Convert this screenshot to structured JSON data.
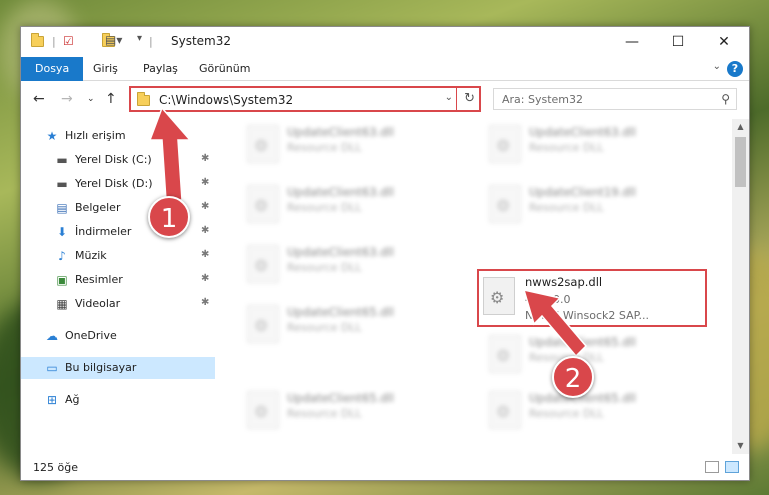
{
  "window": {
    "title": "System32",
    "controls": {
      "minimize": "—",
      "maximize": "☐",
      "close": "✕"
    }
  },
  "ribbon": {
    "tabs": [
      "Dosya",
      "Giriş",
      "Paylaş",
      "Görünüm"
    ]
  },
  "navigation": {
    "address": "C:\\Windows\\System32",
    "search_placeholder": "Ara: System32"
  },
  "sidebar": {
    "items": [
      {
        "label": "Hızlı erişim",
        "icon": "star-icon"
      },
      {
        "label": "Yerel Disk (C:)",
        "icon": "drive-icon",
        "pinned": true
      },
      {
        "label": "Yerel Disk (D:)",
        "icon": "drive-icon",
        "pinned": true
      },
      {
        "label": "Belgeler",
        "icon": "document-icon",
        "pinned": true
      },
      {
        "label": "İndirmeler",
        "icon": "download-icon",
        "pinned": true
      },
      {
        "label": "Müzik",
        "icon": "music-icon",
        "pinned": true
      },
      {
        "label": "Resimler",
        "icon": "picture-icon",
        "pinned": true
      },
      {
        "label": "Videolar",
        "icon": "video-icon",
        "pinned": true
      },
      {
        "label": "OneDrive",
        "icon": "cloud-icon"
      },
      {
        "label": "Bu bilgisayar",
        "icon": "computer-icon",
        "selected": true
      },
      {
        "label": "Ağ",
        "icon": "network-icon"
      }
    ]
  },
  "files": [
    {
      "name": "UpdateClient63.dll",
      "type": "Resource DLL",
      "blurred": true
    },
    {
      "name": "UpdateClient63.dll",
      "type": "Resource DLL",
      "blurred": true
    },
    {
      "name": "UpdateClient63.dll",
      "type": "Resource DLL",
      "blurred": true
    },
    {
      "name": "UpdateClient19.dll",
      "type": "Resource DLL",
      "blurred": true
    },
    {
      "name": "UpdateClient63.dll",
      "type": "Resource DLL",
      "blurred": true
    },
    {
      "name": "nwws2sap.dll",
      "type": "4.71.0.0",
      "description": "Novell Winsock2 SAP...",
      "blurred": false,
      "highlighted": true
    },
    {
      "name": "UpdateClient65.dll",
      "type": "Resource DLL",
      "blurred": true
    },
    {
      "name": "UpdateClient65.dll",
      "type": "Resource DLL",
      "blurred": true
    },
    {
      "name": "UpdateClient65.dll",
      "type": "Resource DLL",
      "blurred": true
    },
    {
      "name": "UpdateClient65.dll",
      "type": "Resource DLL",
      "blurred": true
    }
  ],
  "status": {
    "item_count": "125 öğe"
  },
  "annotations": {
    "step1": "1",
    "step2": "2"
  },
  "colors": {
    "accent": "#1979ca",
    "highlight": "#d9474b",
    "selected_bg": "#cce8ff"
  }
}
